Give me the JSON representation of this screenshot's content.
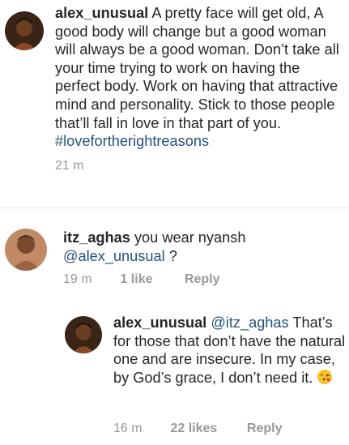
{
  "caption": {
    "username": "alex_unusual",
    "text": "A pretty face will get old, A good body will change but a good woman will always be a good woman. Don’t take all your time trying to work on having the perfect body. Work on having that attractive mind and personality. Stick to those people that’ll fall in love in that part of you.",
    "hashtag": "#lovefortherightreasons",
    "time": "21 m"
  },
  "comment1": {
    "username": "itz_aghas",
    "text": "you wear nyansh",
    "mention": "@alex_unusual",
    "text_after": " ?",
    "time": "19 m",
    "likes": "1 like",
    "reply": "Reply"
  },
  "reply1": {
    "username": "alex_unusual",
    "mention": "@itz_aghas",
    "text": "That’s for those that don’t have the natural one and are insecure. In my case, by God’s grace, I don’t need it.",
    "emoji": "face-blowing-kiss-emoji",
    "time": "16 m",
    "likes": "22 likes",
    "reply": "Reply"
  },
  "colors": {
    "text": "#262626",
    "meta": "#999999",
    "link": "#24527a",
    "divider": "#e6e6e6"
  }
}
